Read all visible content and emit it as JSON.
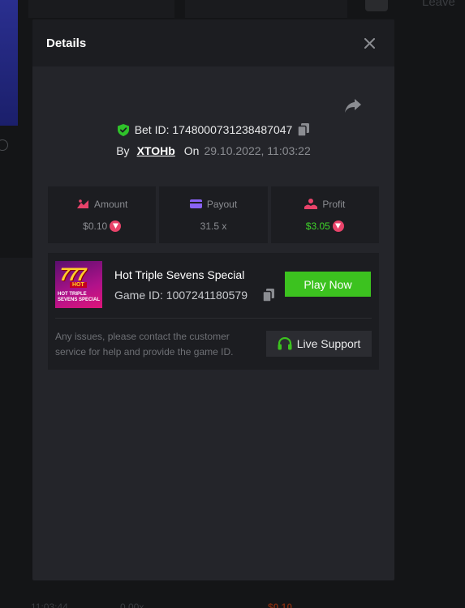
{
  "background": {
    "leave_label": "Leave",
    "footer_time": "11:03:44",
    "footer_multiplier": "0.00x",
    "footer_amount": "$0.10"
  },
  "modal": {
    "title": "Details",
    "bet": {
      "id_prefix": "Bet ID:",
      "id": "1748000731238487047",
      "by_label": "By",
      "username": "XTOHb",
      "on_label": "On",
      "datetime": "29.10.2022, 11:03:22"
    },
    "stats": [
      {
        "label": "Amount",
        "value": "$0.10",
        "icon": "amount-icon",
        "color": "#e8436a",
        "coin": true
      },
      {
        "label": "Payout",
        "value": "31.5 x",
        "icon": "card-icon",
        "color": "#8a63f5",
        "coin": false
      },
      {
        "label": "Profit",
        "value": "$3.05",
        "icon": "profit-icon",
        "color": "#e8436a",
        "coin": true
      }
    ],
    "game": {
      "name": "Hot Triple Sevens Special",
      "id_label": "Game ID: 1007241180579",
      "thumb_digits": "777",
      "thumb_hot": "HOT",
      "thumb_line1": "HOT TRIPLE",
      "thumb_line2": "SEVENS SPECIAL",
      "play_label": "Play Now"
    },
    "support": {
      "text": "Any issues, please contact the customer service for help and provide the game ID.",
      "button_label": "Live Support"
    }
  },
  "colors": {
    "accent_green": "#3cc21f",
    "profit_green": "#3fd42a",
    "coin_pink": "#e8436a",
    "shield_green": "#2fc22a"
  }
}
